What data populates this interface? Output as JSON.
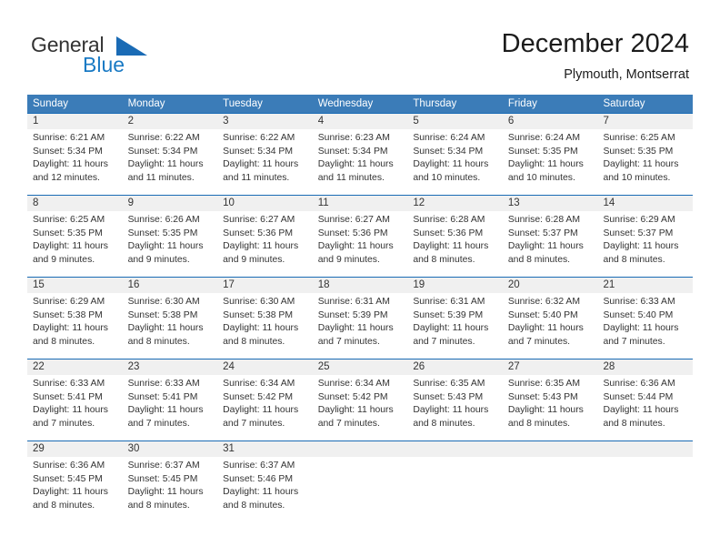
{
  "brand": {
    "name_part1": "General",
    "name_part2": "Blue",
    "triangle_color": "#1a6bb5",
    "blue_text_color": "#1a7ac4"
  },
  "header": {
    "month_title": "December 2024",
    "location": "Plymouth, Montserrat"
  },
  "theme": {
    "header_row_bg": "#3b7cb8",
    "row_divider": "#1a6bb5",
    "day_number_bg": "#f0f0f0",
    "text_color": "#333333"
  },
  "weekdays": [
    "Sunday",
    "Monday",
    "Tuesday",
    "Wednesday",
    "Thursday",
    "Friday",
    "Saturday"
  ],
  "weeks": [
    {
      "numbers": [
        "1",
        "2",
        "3",
        "4",
        "5",
        "6",
        "7"
      ],
      "days": [
        {
          "sunrise": "Sunrise: 6:21 AM",
          "sunset": "Sunset: 5:34 PM",
          "daylight1": "Daylight: 11 hours",
          "daylight2": "and 12 minutes."
        },
        {
          "sunrise": "Sunrise: 6:22 AM",
          "sunset": "Sunset: 5:34 PM",
          "daylight1": "Daylight: 11 hours",
          "daylight2": "and 11 minutes."
        },
        {
          "sunrise": "Sunrise: 6:22 AM",
          "sunset": "Sunset: 5:34 PM",
          "daylight1": "Daylight: 11 hours",
          "daylight2": "and 11 minutes."
        },
        {
          "sunrise": "Sunrise: 6:23 AM",
          "sunset": "Sunset: 5:34 PM",
          "daylight1": "Daylight: 11 hours",
          "daylight2": "and 11 minutes."
        },
        {
          "sunrise": "Sunrise: 6:24 AM",
          "sunset": "Sunset: 5:34 PM",
          "daylight1": "Daylight: 11 hours",
          "daylight2": "and 10 minutes."
        },
        {
          "sunrise": "Sunrise: 6:24 AM",
          "sunset": "Sunset: 5:35 PM",
          "daylight1": "Daylight: 11 hours",
          "daylight2": "and 10 minutes."
        },
        {
          "sunrise": "Sunrise: 6:25 AM",
          "sunset": "Sunset: 5:35 PM",
          "daylight1": "Daylight: 11 hours",
          "daylight2": "and 10 minutes."
        }
      ]
    },
    {
      "numbers": [
        "8",
        "9",
        "10",
        "11",
        "12",
        "13",
        "14"
      ],
      "days": [
        {
          "sunrise": "Sunrise: 6:25 AM",
          "sunset": "Sunset: 5:35 PM",
          "daylight1": "Daylight: 11 hours",
          "daylight2": "and 9 minutes."
        },
        {
          "sunrise": "Sunrise: 6:26 AM",
          "sunset": "Sunset: 5:35 PM",
          "daylight1": "Daylight: 11 hours",
          "daylight2": "and 9 minutes."
        },
        {
          "sunrise": "Sunrise: 6:27 AM",
          "sunset": "Sunset: 5:36 PM",
          "daylight1": "Daylight: 11 hours",
          "daylight2": "and 9 minutes."
        },
        {
          "sunrise": "Sunrise: 6:27 AM",
          "sunset": "Sunset: 5:36 PM",
          "daylight1": "Daylight: 11 hours",
          "daylight2": "and 9 minutes."
        },
        {
          "sunrise": "Sunrise: 6:28 AM",
          "sunset": "Sunset: 5:36 PM",
          "daylight1": "Daylight: 11 hours",
          "daylight2": "and 8 minutes."
        },
        {
          "sunrise": "Sunrise: 6:28 AM",
          "sunset": "Sunset: 5:37 PM",
          "daylight1": "Daylight: 11 hours",
          "daylight2": "and 8 minutes."
        },
        {
          "sunrise": "Sunrise: 6:29 AM",
          "sunset": "Sunset: 5:37 PM",
          "daylight1": "Daylight: 11 hours",
          "daylight2": "and 8 minutes."
        }
      ]
    },
    {
      "numbers": [
        "15",
        "16",
        "17",
        "18",
        "19",
        "20",
        "21"
      ],
      "days": [
        {
          "sunrise": "Sunrise: 6:29 AM",
          "sunset": "Sunset: 5:38 PM",
          "daylight1": "Daylight: 11 hours",
          "daylight2": "and 8 minutes."
        },
        {
          "sunrise": "Sunrise: 6:30 AM",
          "sunset": "Sunset: 5:38 PM",
          "daylight1": "Daylight: 11 hours",
          "daylight2": "and 8 minutes."
        },
        {
          "sunrise": "Sunrise: 6:30 AM",
          "sunset": "Sunset: 5:38 PM",
          "daylight1": "Daylight: 11 hours",
          "daylight2": "and 8 minutes."
        },
        {
          "sunrise": "Sunrise: 6:31 AM",
          "sunset": "Sunset: 5:39 PM",
          "daylight1": "Daylight: 11 hours",
          "daylight2": "and 7 minutes."
        },
        {
          "sunrise": "Sunrise: 6:31 AM",
          "sunset": "Sunset: 5:39 PM",
          "daylight1": "Daylight: 11 hours",
          "daylight2": "and 7 minutes."
        },
        {
          "sunrise": "Sunrise: 6:32 AM",
          "sunset": "Sunset: 5:40 PM",
          "daylight1": "Daylight: 11 hours",
          "daylight2": "and 7 minutes."
        },
        {
          "sunrise": "Sunrise: 6:33 AM",
          "sunset": "Sunset: 5:40 PM",
          "daylight1": "Daylight: 11 hours",
          "daylight2": "and 7 minutes."
        }
      ]
    },
    {
      "numbers": [
        "22",
        "23",
        "24",
        "25",
        "26",
        "27",
        "28"
      ],
      "days": [
        {
          "sunrise": "Sunrise: 6:33 AM",
          "sunset": "Sunset: 5:41 PM",
          "daylight1": "Daylight: 11 hours",
          "daylight2": "and 7 minutes."
        },
        {
          "sunrise": "Sunrise: 6:33 AM",
          "sunset": "Sunset: 5:41 PM",
          "daylight1": "Daylight: 11 hours",
          "daylight2": "and 7 minutes."
        },
        {
          "sunrise": "Sunrise: 6:34 AM",
          "sunset": "Sunset: 5:42 PM",
          "daylight1": "Daylight: 11 hours",
          "daylight2": "and 7 minutes."
        },
        {
          "sunrise": "Sunrise: 6:34 AM",
          "sunset": "Sunset: 5:42 PM",
          "daylight1": "Daylight: 11 hours",
          "daylight2": "and 7 minutes."
        },
        {
          "sunrise": "Sunrise: 6:35 AM",
          "sunset": "Sunset: 5:43 PM",
          "daylight1": "Daylight: 11 hours",
          "daylight2": "and 8 minutes."
        },
        {
          "sunrise": "Sunrise: 6:35 AM",
          "sunset": "Sunset: 5:43 PM",
          "daylight1": "Daylight: 11 hours",
          "daylight2": "and 8 minutes."
        },
        {
          "sunrise": "Sunrise: 6:36 AM",
          "sunset": "Sunset: 5:44 PM",
          "daylight1": "Daylight: 11 hours",
          "daylight2": "and 8 minutes."
        }
      ]
    },
    {
      "numbers": [
        "29",
        "30",
        "31",
        "",
        "",
        "",
        ""
      ],
      "days": [
        {
          "sunrise": "Sunrise: 6:36 AM",
          "sunset": "Sunset: 5:45 PM",
          "daylight1": "Daylight: 11 hours",
          "daylight2": "and 8 minutes."
        },
        {
          "sunrise": "Sunrise: 6:37 AM",
          "sunset": "Sunset: 5:45 PM",
          "daylight1": "Daylight: 11 hours",
          "daylight2": "and 8 minutes."
        },
        {
          "sunrise": "Sunrise: 6:37 AM",
          "sunset": "Sunset: 5:46 PM",
          "daylight1": "Daylight: 11 hours",
          "daylight2": "and 8 minutes."
        },
        {
          "sunrise": "",
          "sunset": "",
          "daylight1": "",
          "daylight2": ""
        },
        {
          "sunrise": "",
          "sunset": "",
          "daylight1": "",
          "daylight2": ""
        },
        {
          "sunrise": "",
          "sunset": "",
          "daylight1": "",
          "daylight2": ""
        },
        {
          "sunrise": "",
          "sunset": "",
          "daylight1": "",
          "daylight2": ""
        }
      ]
    }
  ]
}
